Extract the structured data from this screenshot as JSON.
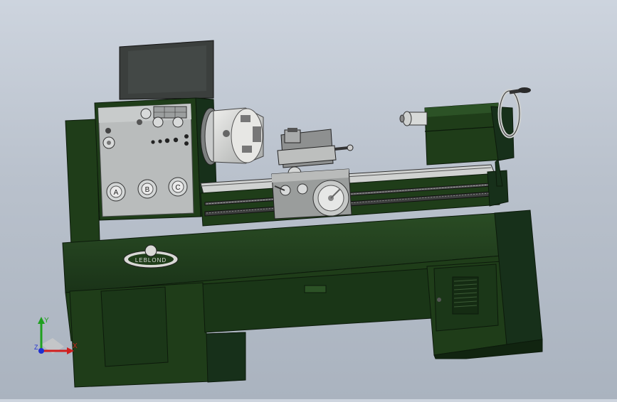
{
  "viewport": {
    "background_top": "#cdd4de",
    "background_bottom": "#aab3bf"
  },
  "model": {
    "body_color": "#1f3d19",
    "body_shade": "#17301a",
    "body_light": "#2c5226",
    "metal_color": "#d9d9d6",
    "metal_dark": "#9fa2a2",
    "edge_color": "#0c1a0b",
    "headstock_controls": [
      "A",
      "B",
      "C"
    ],
    "nameplate_text": "LEBLOND"
  },
  "triad": {
    "x_label": "X",
    "y_label": "Y",
    "z_label": "Z",
    "x_color": "#d11f1f",
    "y_color": "#1fa01f",
    "z_color": "#1f2fd1"
  }
}
